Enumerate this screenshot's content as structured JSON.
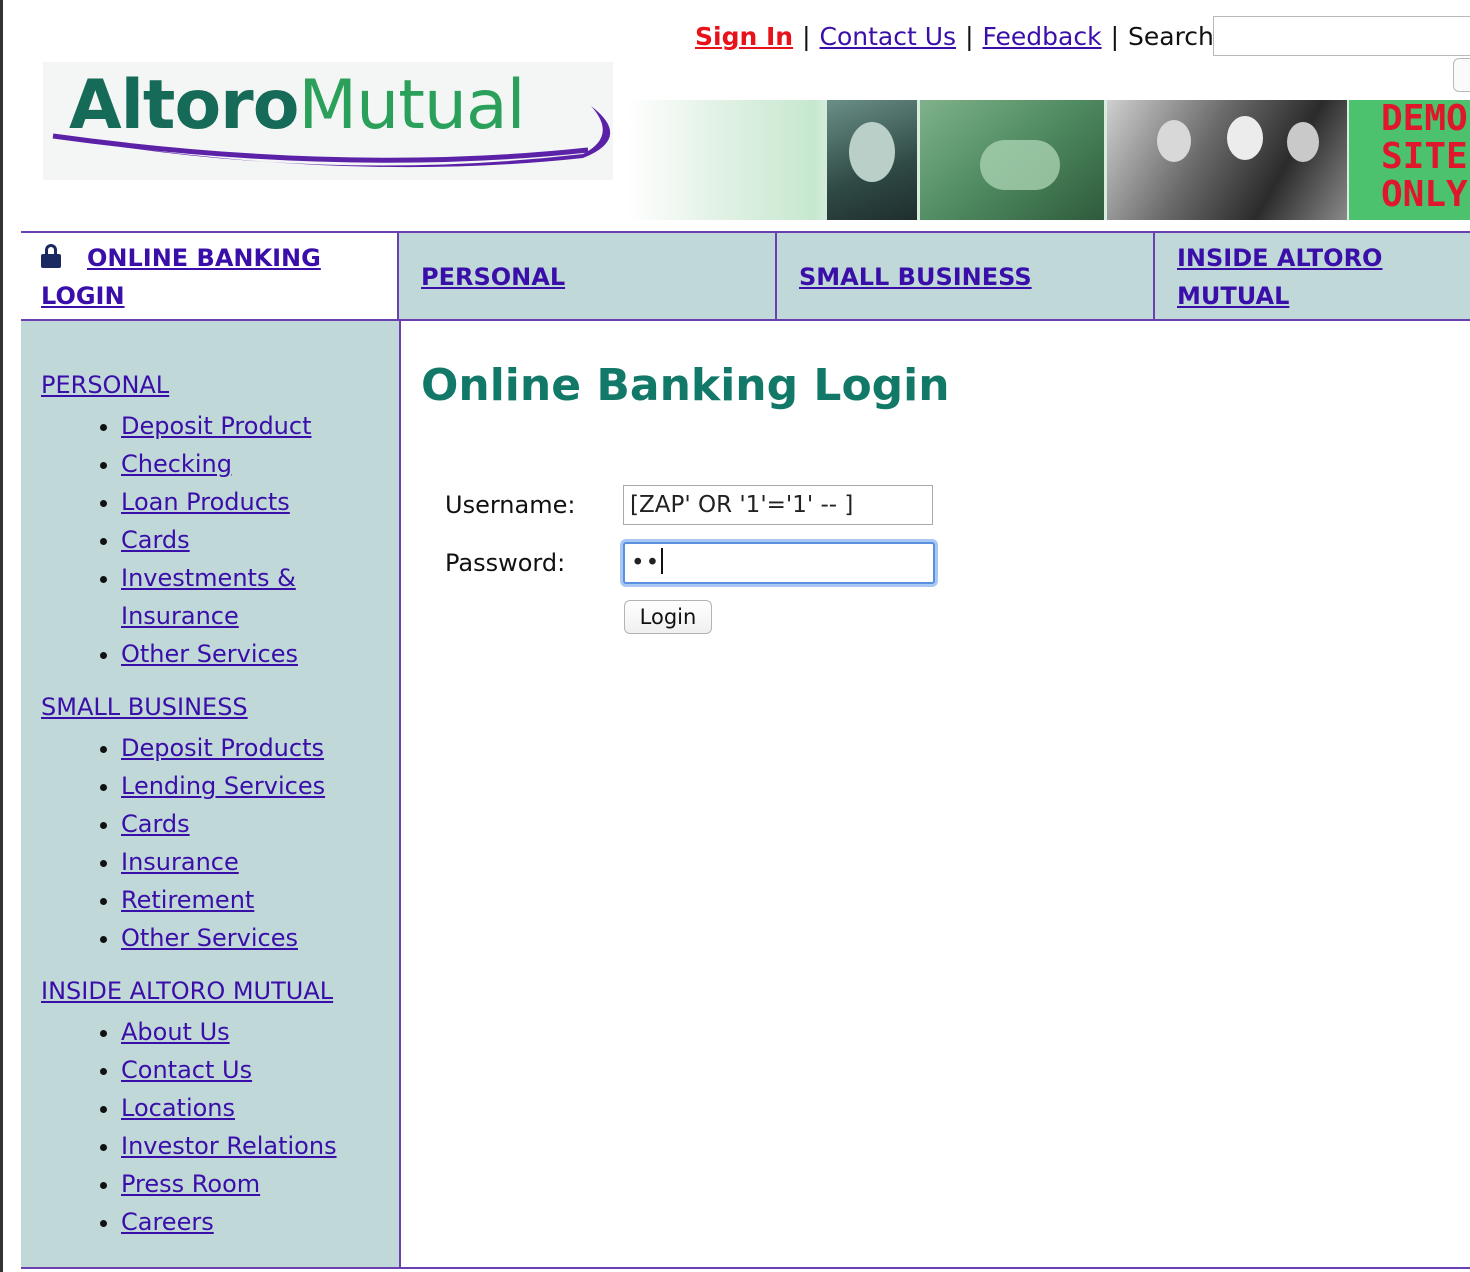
{
  "header": {
    "sign_in": "Sign In",
    "contact_us": "Contact Us",
    "feedback": "Feedback",
    "separator": "|",
    "search_label": "Search",
    "search_value": ""
  },
  "logo": {
    "word1": "Altoro",
    "word2": "Mutual"
  },
  "banner": {
    "demo_text": "DEMO\nSITE\nONLY"
  },
  "nav": {
    "online_banking_login": "ONLINE BANKING LOGIN",
    "personal": "PERSONAL",
    "small_business": "SMALL BUSINESS",
    "inside_altoro_mutual": "INSIDE ALTORO MUTUAL"
  },
  "sidebar": {
    "sections": [
      {
        "heading": "PERSONAL",
        "items": [
          "Deposit Product",
          "Checking",
          "Loan Products",
          "Cards",
          "Investments & Insurance",
          "Other Services"
        ]
      },
      {
        "heading": "SMALL BUSINESS",
        "items": [
          "Deposit Products",
          "Lending Services",
          "Cards",
          "Insurance",
          "Retirement",
          "Other Services"
        ]
      },
      {
        "heading": "INSIDE ALTORO MUTUAL",
        "items": [
          "About Us",
          "Contact Us",
          "Locations",
          "Investor Relations",
          "Press Room",
          "Careers"
        ]
      }
    ]
  },
  "main": {
    "title": "Online Banking Login",
    "username_label": "Username:",
    "username_value": "[ZAP' OR '1'='1' -- ]",
    "password_label": "Password:",
    "password_value": "••",
    "login_button": "Login"
  },
  "colors": {
    "link": "#3a0ea8",
    "sign_in": "#e8121b",
    "title": "#127868",
    "nav_bg": "#c0d8d8",
    "border": "#6a3fb0"
  }
}
